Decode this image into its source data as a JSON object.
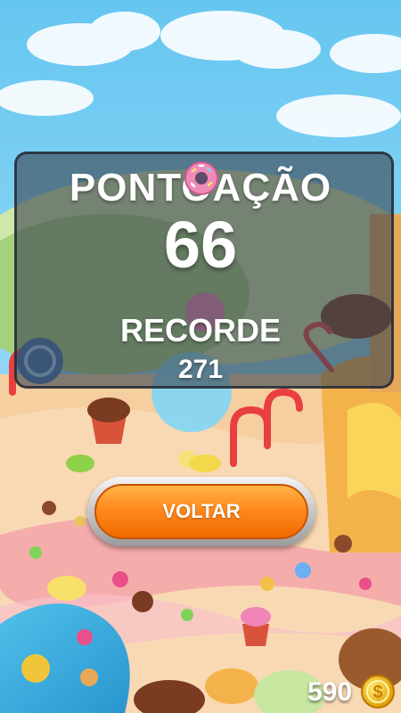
{
  "result": {
    "score_label": "PONTOAÇÃO",
    "score_value": "66",
    "record_label": "RECORDE",
    "record_value": "271"
  },
  "actions": {
    "back_label": "VOLTAR"
  },
  "wallet": {
    "coins": "590"
  },
  "colors": {
    "panel": "#3c4650",
    "button": "#ff8a1f",
    "sky": "#7fd3f5"
  },
  "icons": [
    "donut-icon",
    "candy-cane-icon",
    "coin-icon"
  ]
}
